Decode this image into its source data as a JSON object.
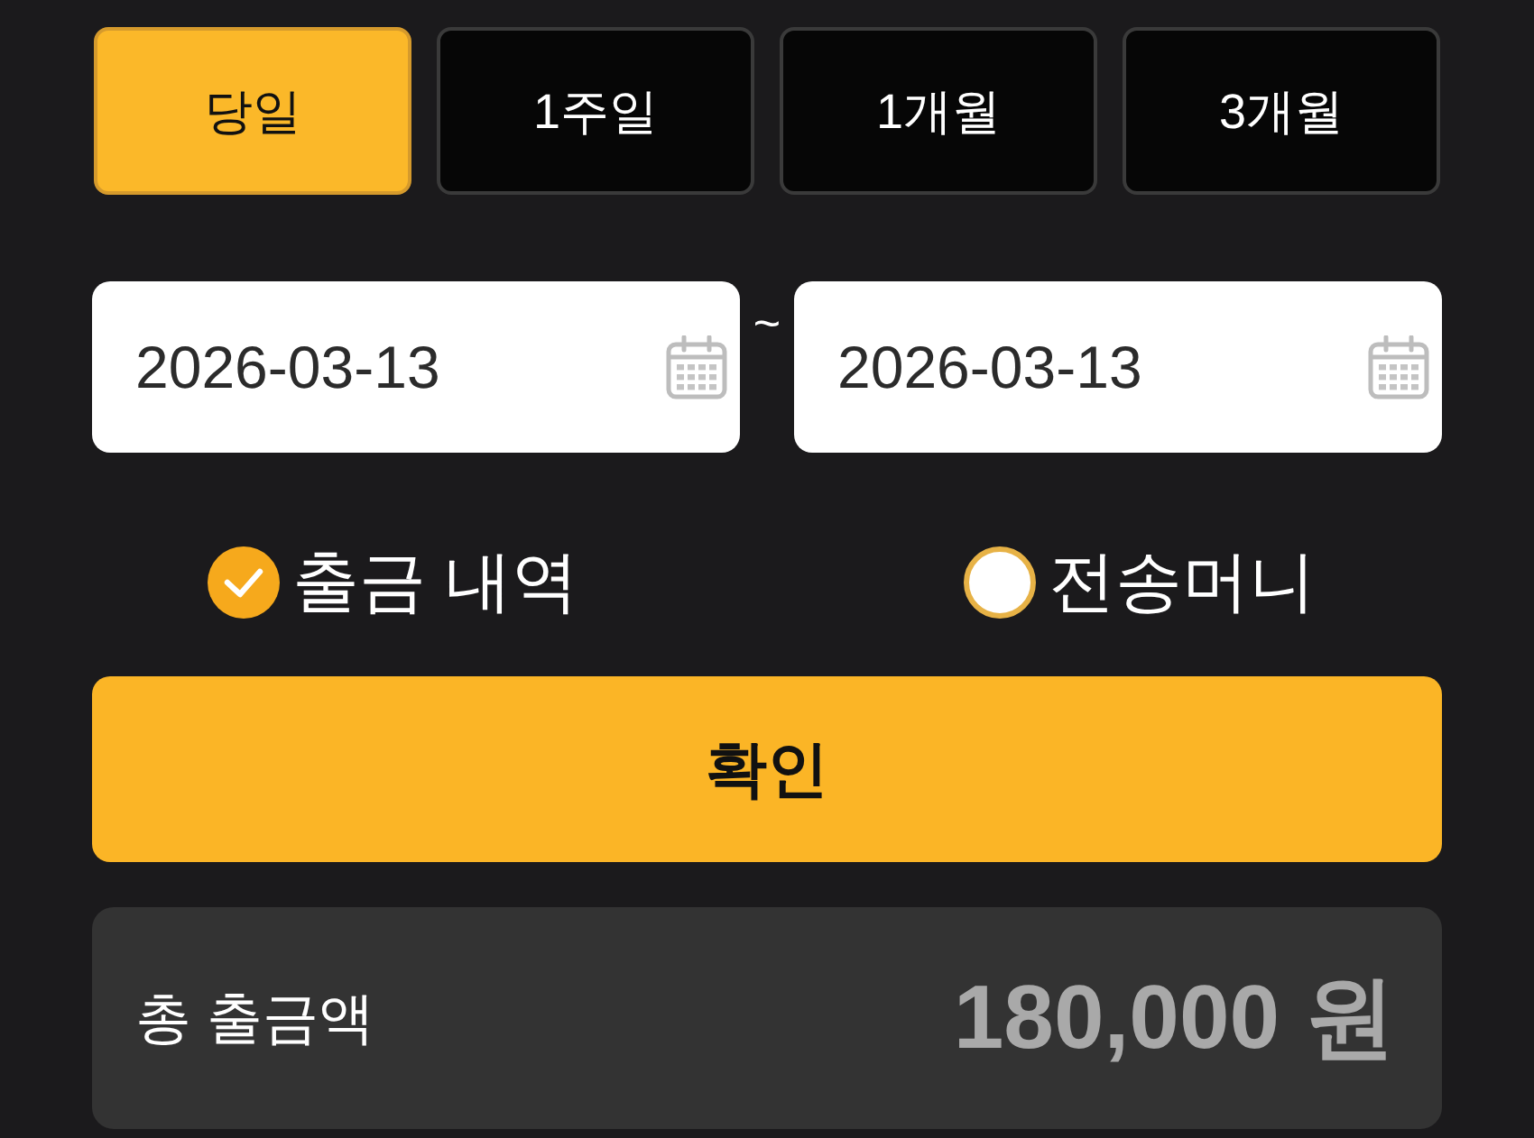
{
  "period_tabs": [
    {
      "label": "당일",
      "selected": true
    },
    {
      "label": "1주일",
      "selected": false
    },
    {
      "label": "1개월",
      "selected": false
    },
    {
      "label": "3개월",
      "selected": false
    }
  ],
  "date_range": {
    "start": {
      "value": "2026-03-13"
    },
    "separator": "~",
    "end": {
      "value": "2026-03-13"
    }
  },
  "options": [
    {
      "label": "출금 내역",
      "selected": true
    },
    {
      "label": "전송머니",
      "selected": false
    }
  ],
  "confirm_button": {
    "label": "확인"
  },
  "summary": {
    "label": "총 출금액",
    "value": "180,000 원"
  }
}
